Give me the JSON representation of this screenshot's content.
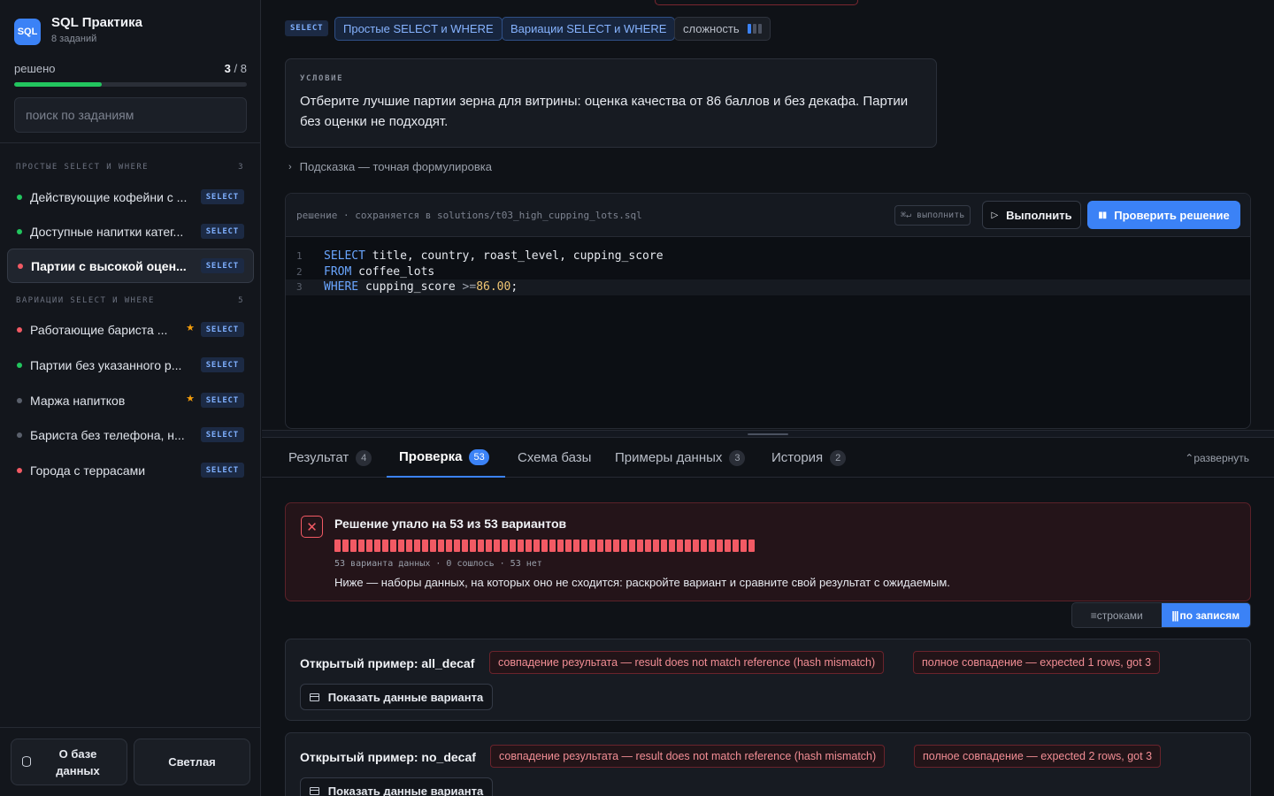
{
  "sidebar": {
    "logo": "SQL",
    "title": "SQL Практика",
    "subtitle": "8 заданий",
    "progress_label": "решено",
    "solved": "3",
    "total": "/ 8",
    "progress_fraction": 0.375,
    "search_placeholder": "поиск по заданиям",
    "groups": [
      {
        "title": "ПРОСТЫЕ SELECT И WHERE",
        "count": "3"
      },
      {
        "title": "ВАРИАЦИИ SELECT И WHERE",
        "count": "5"
      }
    ],
    "tasks": [
      {
        "label": "Действующие кофейни с ...",
        "status": "green",
        "badge": "SELECT",
        "star": false
      },
      {
        "label": "Доступные напитки катег...",
        "status": "green",
        "badge": "SELECT",
        "star": false
      },
      {
        "label": "Партии с высокой оцен...",
        "status": "red",
        "badge": "SELECT",
        "star": false,
        "active": true
      },
      {
        "label": "Работающие бариста ...",
        "status": "red",
        "badge": "SELECT",
        "star": true
      },
      {
        "label": "Партии без указанного р...",
        "status": "green",
        "badge": "SELECT",
        "star": false
      },
      {
        "label": "Маржа напитков",
        "status": "grey",
        "badge": "SELECT",
        "star": true
      },
      {
        "label": "Бариста без телефона, н...",
        "status": "grey",
        "badge": "SELECT",
        "star": false
      },
      {
        "label": "Города с террасами",
        "status": "red",
        "badge": "SELECT",
        "star": false
      }
    ],
    "db_button": "О базе данных",
    "theme_button": "Светлая"
  },
  "task_header": {
    "kind": "SELECT",
    "topics": [
      "Простые SELECT и WHERE",
      "Вариации SELECT и WHERE"
    ],
    "difficulty_label": "сложность",
    "difficulty_level": 1,
    "difficulty_max": 3
  },
  "condition": {
    "label": "УСЛОВИЕ",
    "text": "Отберите лучшие партии зерна для витрины: оценка качества от 86 баллов и без декафа. Партии без оценки не подходят."
  },
  "hint": "Подсказка — точная формулировка",
  "editor": {
    "path": "решение · сохраняется в solutions/t03_high_cupping_lots.sql",
    "shortcut": "⌘↵ выполнить",
    "run_label": "Выполнить",
    "check_label": "Проверить решение",
    "lines": [
      {
        "n": "1",
        "kw": "SELECT",
        "rest": " title, country, roast_level, cupping_score"
      },
      {
        "n": "2",
        "kw": "FROM",
        "rest": " coffee_lots"
      },
      {
        "n": "3",
        "kw": "WHERE",
        "rest": " cupping_score ",
        "op": ">=",
        "num": "86.00",
        "end": ";"
      }
    ]
  },
  "tabs": [
    {
      "label": "Результат",
      "count": "4"
    },
    {
      "label": "Проверка",
      "count": "53",
      "active": true
    },
    {
      "label": "Схема базы",
      "count": ""
    },
    {
      "label": "Примеры данных",
      "count": "3"
    },
    {
      "label": "История",
      "count": "2"
    }
  ],
  "expand_label": "развернуть",
  "verdict": {
    "title": "Решение упало на 53 из 53 вариантов",
    "failed_count": 53,
    "stats": "53 варианта данных · 0 сошлось · 53 нет",
    "description": "Ниже — наборы данных, на которых оно не сходится: раскройте вариант и сравните свой результат с ожидаемым."
  },
  "view_toggle": {
    "rows": "строками",
    "records": "по записям"
  },
  "cases": [
    {
      "title": "Открытый пример: all_decaf",
      "tags": [
        "совпадение результата — result does not match reference (hash mismatch)",
        "полное совпадение — expected 1 rows, got 3"
      ],
      "button": "Показать данные варианта"
    },
    {
      "title": "Открытый пример: no_decaf",
      "tags": [
        "совпадение результата — result does not match reference (hash mismatch)",
        "полное совпадение — expected 2 rows, got 3"
      ],
      "button": "Показать данные варианта"
    }
  ]
}
